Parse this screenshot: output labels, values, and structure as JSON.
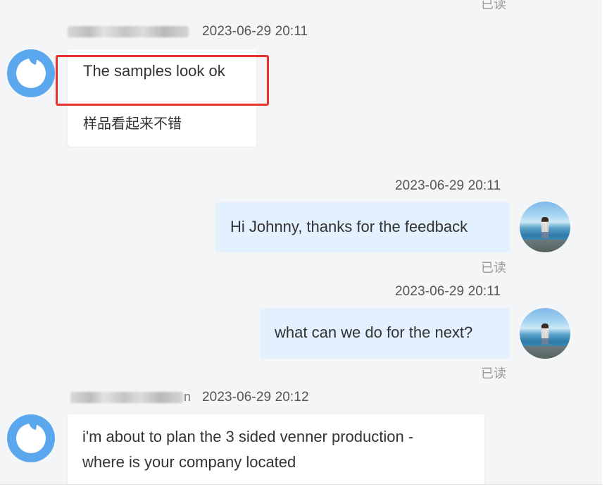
{
  "read_label": "已读",
  "messages": [
    {
      "direction": "incoming",
      "sender_tail": "",
      "timestamp": "2023-06-29 20:11",
      "text": "The samples look ok",
      "translation": "样品看起来不错",
      "highlighted": true
    },
    {
      "direction": "outgoing",
      "timestamp": "2023-06-29 20:11",
      "text": "Hi Johnny, thanks for the feedback",
      "status": "已读"
    },
    {
      "direction": "outgoing",
      "timestamp": "2023-06-29 20:11",
      "text": "what can we do for the next?",
      "status": "已读"
    },
    {
      "direction": "incoming",
      "sender_tail": "n",
      "timestamp": "2023-06-29 20:12",
      "text_lines": [
        "i'm about to plan the 3 sided venner production -",
        "where is your company located"
      ]
    }
  ],
  "colors": {
    "panel_bg": "#f4f5f6",
    "outgoing_bubble": "#e3f0fd",
    "incoming_bubble": "#ffffff",
    "highlight_border": "#e8302d",
    "bot_avatar": "#5ba7ee"
  },
  "icons": {
    "incoming_avatar": "chat-bubble-logo-icon",
    "outgoing_avatar": "user-photo-avatar"
  }
}
